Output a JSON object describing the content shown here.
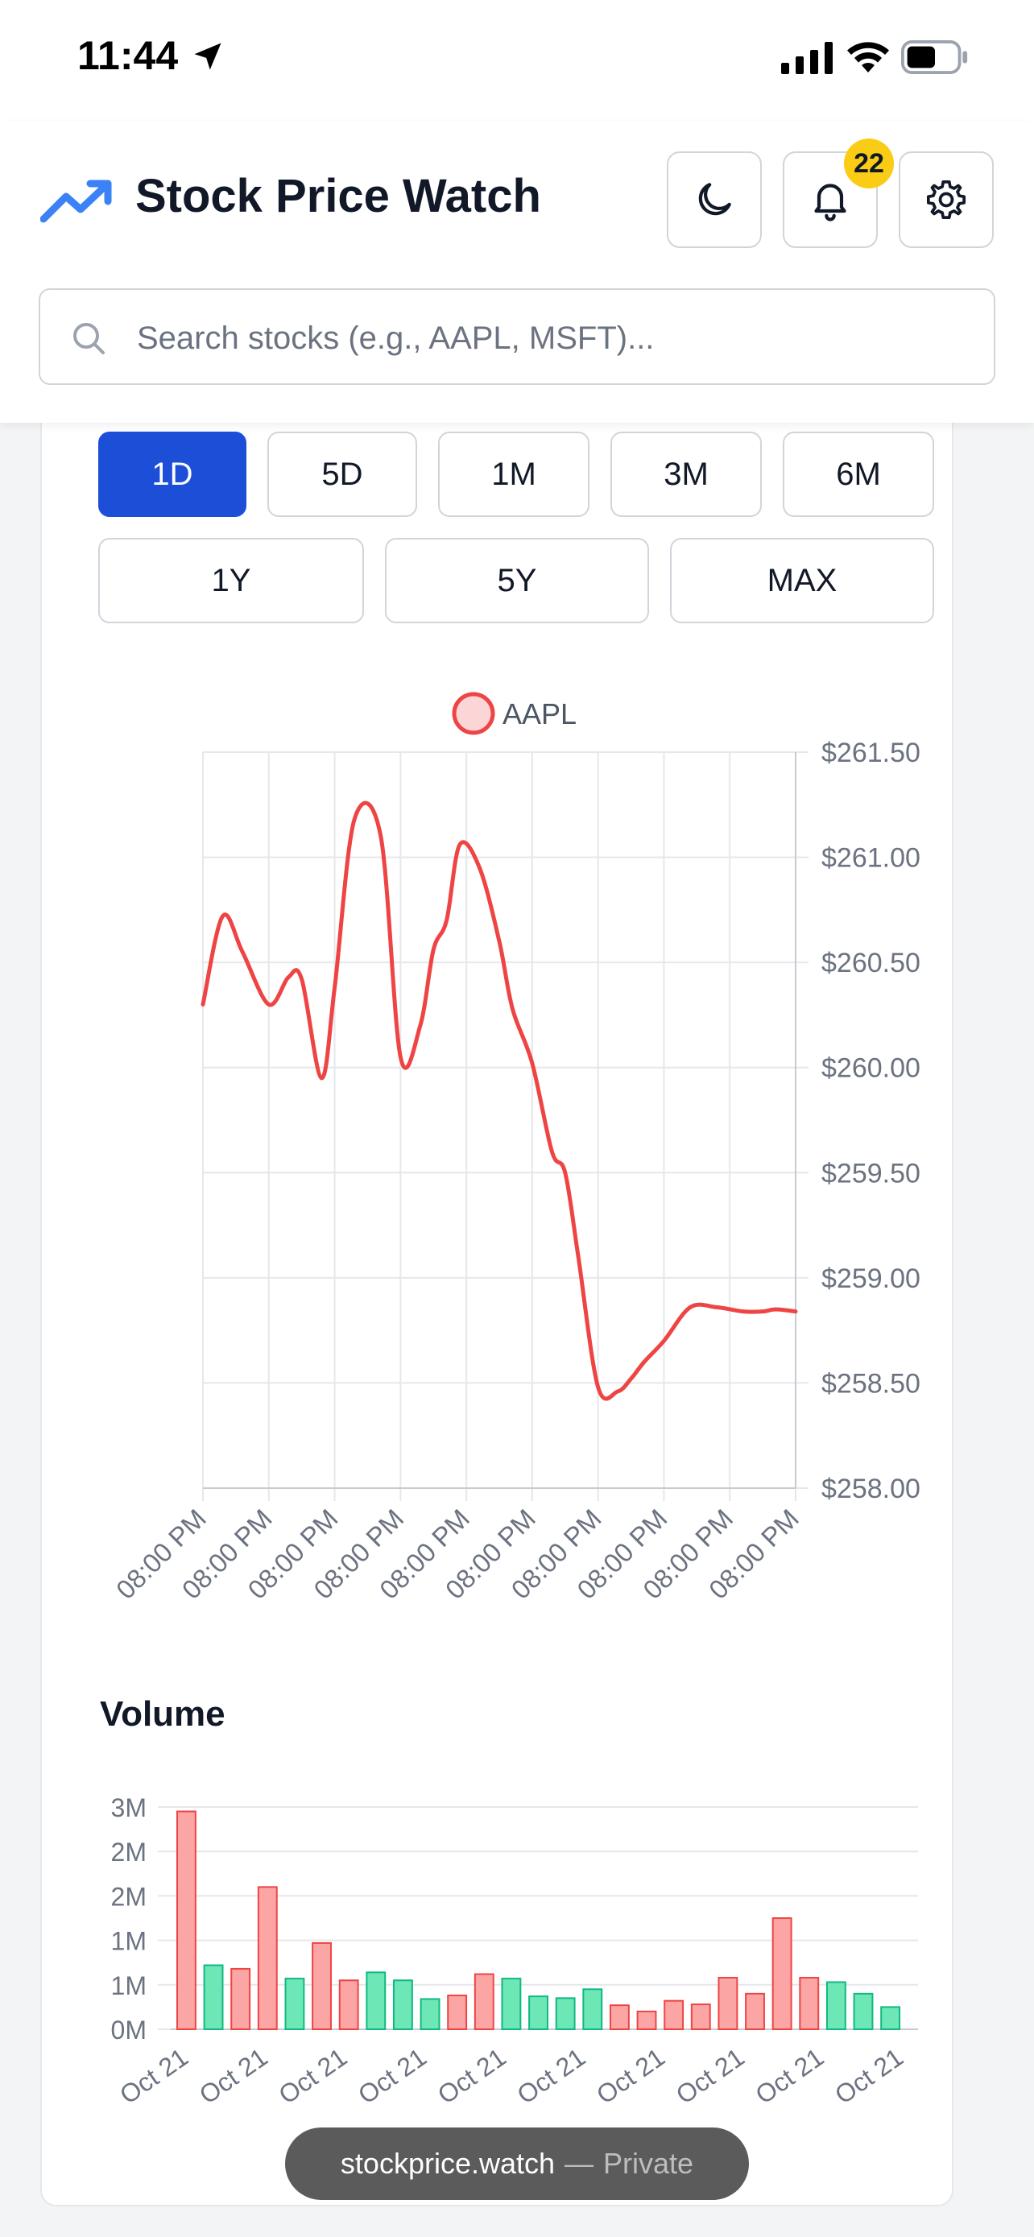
{
  "status": {
    "time": "11:44"
  },
  "header": {
    "title": "Stock Price Watch",
    "notification_count": "22",
    "accent_color": "#3b82f6"
  },
  "search": {
    "placeholder": "Search stocks (e.g., AAPL, MSFT)...",
    "value": ""
  },
  "time_ranges": [
    {
      "label": "1D",
      "active": true
    },
    {
      "label": "5D",
      "active": false
    },
    {
      "label": "1M",
      "active": false
    },
    {
      "label": "3M",
      "active": false
    },
    {
      "label": "6M",
      "active": false
    },
    {
      "label": "1Y",
      "active": false
    },
    {
      "label": "5Y",
      "active": false
    },
    {
      "label": "MAX",
      "active": false
    }
  ],
  "volume_title": "Volume",
  "browser": {
    "domain": "stockprice.watch",
    "separator": "—",
    "mode": "Private"
  },
  "chart_data": [
    {
      "type": "line",
      "series": [
        {
          "name": "AAPL",
          "color": "#ef4444",
          "x": [
            0,
            0.3,
            0.6,
            1.0,
            1.3,
            1.5,
            1.8,
            2.0,
            2.3,
            2.7,
            3.0,
            3.3,
            3.5,
            3.7,
            3.9,
            4.2,
            4.5,
            4.7,
            5.0,
            5.3,
            5.5,
            5.7,
            6.0,
            6.3,
            6.5,
            6.7,
            7.0,
            7.4,
            7.8,
            8.2,
            8.5,
            8.7,
            9.0
          ],
          "y": [
            260.3,
            260.72,
            260.55,
            260.3,
            260.43,
            260.42,
            259.95,
            260.38,
            261.18,
            261.1,
            260.05,
            260.2,
            260.56,
            260.7,
            261.06,
            260.95,
            260.6,
            260.28,
            260.02,
            259.6,
            259.5,
            259.1,
            258.48,
            258.46,
            258.52,
            258.6,
            258.7,
            258.86,
            258.86,
            258.84,
            258.84,
            258.85,
            258.84
          ]
        }
      ],
      "x_tick_labels": [
        "08:00 PM",
        "08:00 PM",
        "08:00 PM",
        "08:00 PM",
        "08:00 PM",
        "08:00 PM",
        "08:00 PM",
        "08:00 PM",
        "08:00 PM",
        "08:00 PM"
      ],
      "y_tick_labels": [
        "$261.50",
        "$261.00",
        "$260.50",
        "$260.00",
        "$259.50",
        "$259.00",
        "$258.50",
        "$258.00"
      ],
      "ylim": [
        258.0,
        261.5
      ],
      "xlim": [
        0,
        9
      ],
      "legend": "top",
      "y_axis_side": "right",
      "grid": true
    },
    {
      "type": "bar",
      "title": "Volume",
      "categories": [
        "Oct 21",
        "",
        "",
        "Oct 21",
        "",
        "",
        "Oct 21",
        "",
        "",
        "Oct 21",
        "",
        "",
        "Oct 21",
        "",
        "",
        "Oct 21",
        "",
        "",
        "Oct 21",
        "",
        "",
        "Oct 21",
        "",
        "",
        "Oct 21",
        "",
        "",
        "Oct 21"
      ],
      "x_tick_labels": [
        "Oct 21",
        "Oct 21",
        "Oct 21",
        "Oct 21",
        "Oct 21",
        "Oct 21",
        "Oct 21",
        "Oct 21",
        "Oct 21",
        "Oct 21"
      ],
      "values": [
        2.45,
        0.72,
        0.68,
        1.6,
        0.57,
        0.97,
        0.55,
        0.64,
        0.55,
        0.34,
        0.38,
        0.62,
        0.57,
        0.37,
        0.35,
        0.45,
        0.27,
        0.2,
        0.32,
        0.28,
        0.58,
        0.4,
        1.25,
        0.58,
        0.53,
        0.4,
        0.25
      ],
      "directions": [
        "down",
        "up",
        "down",
        "down",
        "up",
        "down",
        "down",
        "up",
        "up",
        "up",
        "down",
        "down",
        "up",
        "up",
        "up",
        "up",
        "down",
        "down",
        "down",
        "down",
        "down",
        "down",
        "down",
        "down",
        "up",
        "up",
        "up"
      ],
      "colors": {
        "up": "#6ee7b7",
        "down": "#fca5a5",
        "up_border": "#10b981",
        "down_border": "#ef4444"
      },
      "y_tick_labels": [
        "3M",
        "2M",
        "2M",
        "1M",
        "1M",
        "0M"
      ],
      "ylim": [
        0,
        2.5
      ],
      "grid": true
    }
  ]
}
